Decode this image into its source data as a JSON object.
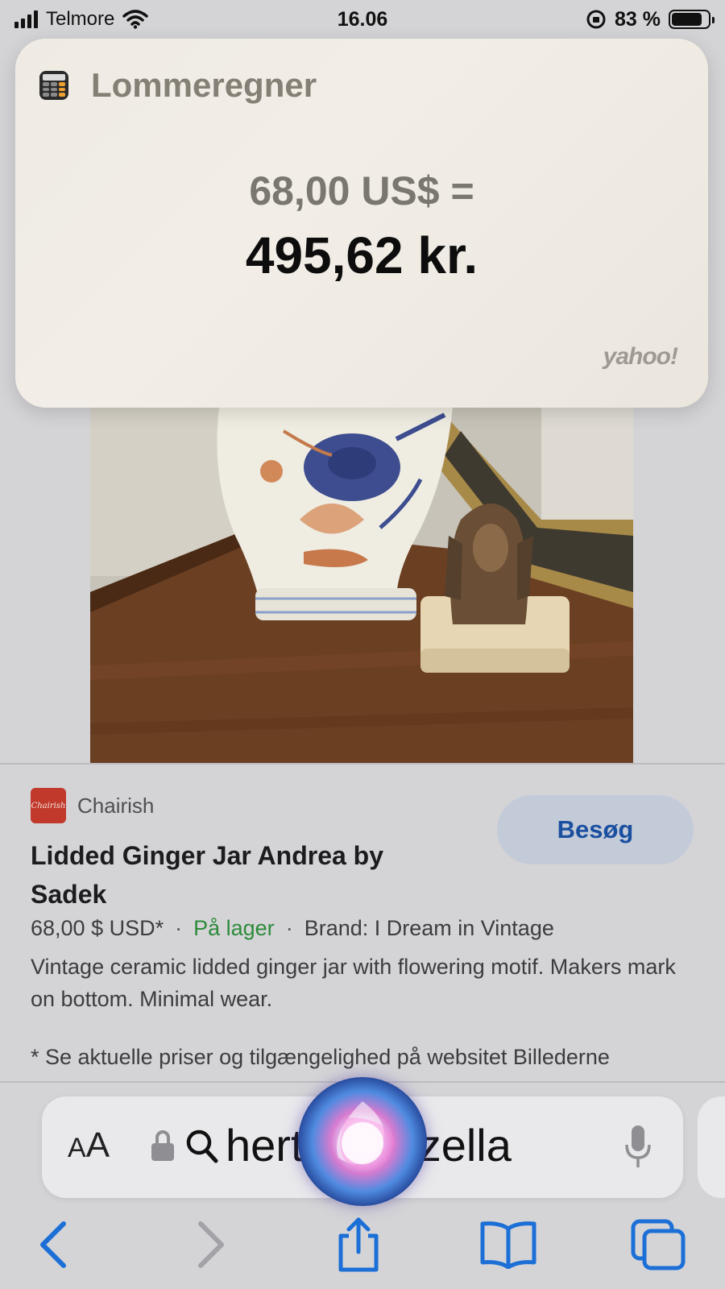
{
  "status_bar": {
    "carrier": "Telmore",
    "time": "16.06",
    "battery_percent": "83 %",
    "battery_level": 0.83
  },
  "siri_card": {
    "app_name": "Lommeregner",
    "icon": "calculator-icon",
    "expression": "68,00 US$ =",
    "result": "495,62 kr.",
    "provider": "yahoo!"
  },
  "result": {
    "source_name": "Chairish",
    "source_logo_text": "Chairish",
    "visit_label": "Besøg",
    "title": "Lidded Ginger Jar Andrea by Sadek",
    "price": "68,00 $ USD*",
    "availability": "På lager",
    "brand": "Brand: I Dream in Vintage",
    "description": "Vintage ceramic lidded ginger jar with flowering motif. Makers mark on bottom. Minimal wear.",
    "footnote": "* Se aktuelle priser og tilgængelighed på websitet Billederne"
  },
  "address_bar": {
    "text_size_label_small": "A",
    "text_size_label_large": "A",
    "url_text_visible": "hert           b porzella"
  },
  "colors": {
    "accent_blue": "#1b6fd6",
    "in_stock_green": "#2e8b3a",
    "source_red": "#c0392b",
    "visit_button_bg": "#c4cbd8"
  },
  "toolbar": {
    "icons": [
      "back-icon",
      "forward-icon",
      "share-icon",
      "bookmarks-icon",
      "tabs-icon"
    ]
  }
}
